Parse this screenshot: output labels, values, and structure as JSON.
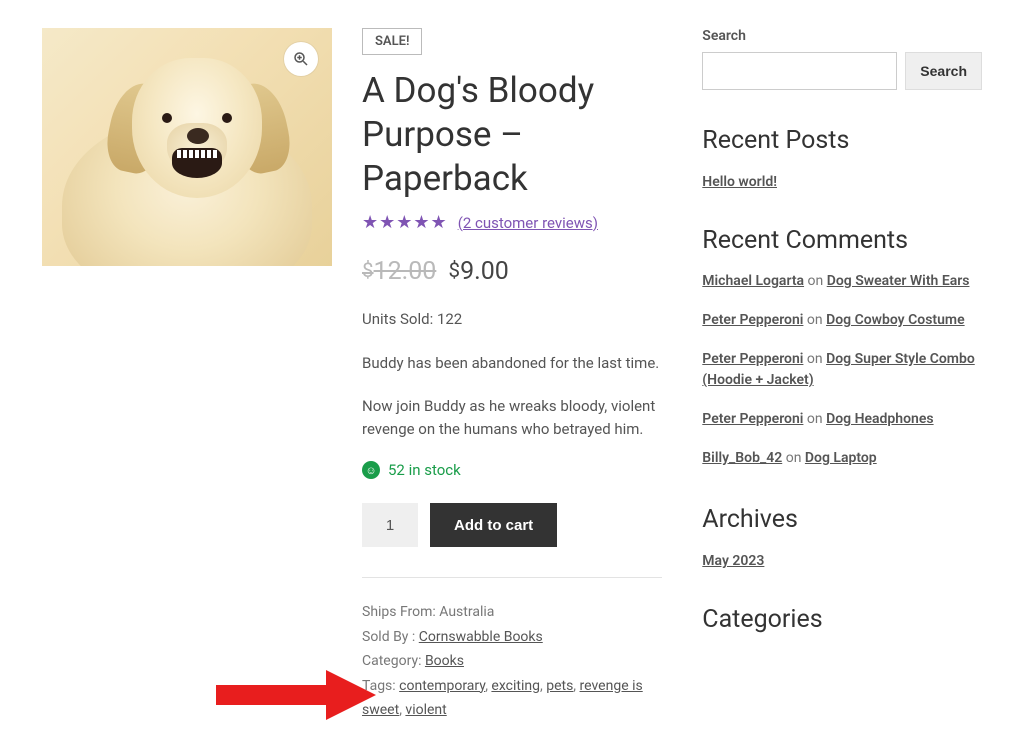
{
  "product": {
    "sale_badge": "SALE!",
    "title": "A Dog's Bloody Purpose – Paperback",
    "reviews_link": "(2 customer reviews)",
    "old_price": "12.00",
    "price": "9.00",
    "currency": "$",
    "units_sold_label": "Units Sold: 122",
    "desc_p1": "Buddy has been abandoned for the last time.",
    "desc_p2": "Now join Buddy as he wreaks bloody, violent revenge on the humans who betrayed him.",
    "stock_text": "52 in stock",
    "qty_value": "1",
    "add_to_cart": "Add to cart",
    "meta": {
      "ships_from_label": "Ships From: ",
      "ships_from": "Australia",
      "sold_by_label": "Sold By : ",
      "sold_by": "Cornswabble Books",
      "category_label": "Category: ",
      "category": "Books",
      "tags_label": "Tags: ",
      "tags": [
        "contemporary",
        "exciting",
        "pets",
        "revenge is sweet",
        "violent"
      ]
    }
  },
  "sidebar": {
    "search_label": "Search",
    "search_button": "Search",
    "recent_posts_title": "Recent Posts",
    "recent_posts": [
      "Hello world!"
    ],
    "recent_comments_title": "Recent Comments",
    "recent_comments": [
      {
        "author": "Michael Logarta",
        "on": " on ",
        "post": "Dog Sweater With Ears"
      },
      {
        "author": "Peter Pepperoni",
        "on": " on ",
        "post": "Dog Cowboy Costume"
      },
      {
        "author": "Peter Pepperoni",
        "on": " on ",
        "post": "Dog Super Style Combo (Hoodie + Jacket)"
      },
      {
        "author": "Peter Pepperoni",
        "on": " on ",
        "post": "Dog Headphones"
      },
      {
        "author": "Billy_Bob_42",
        "on": " on ",
        "post": "Dog Laptop"
      }
    ],
    "archives_title": "Archives",
    "archives": [
      "May 2023"
    ],
    "categories_title": "Categories"
  }
}
